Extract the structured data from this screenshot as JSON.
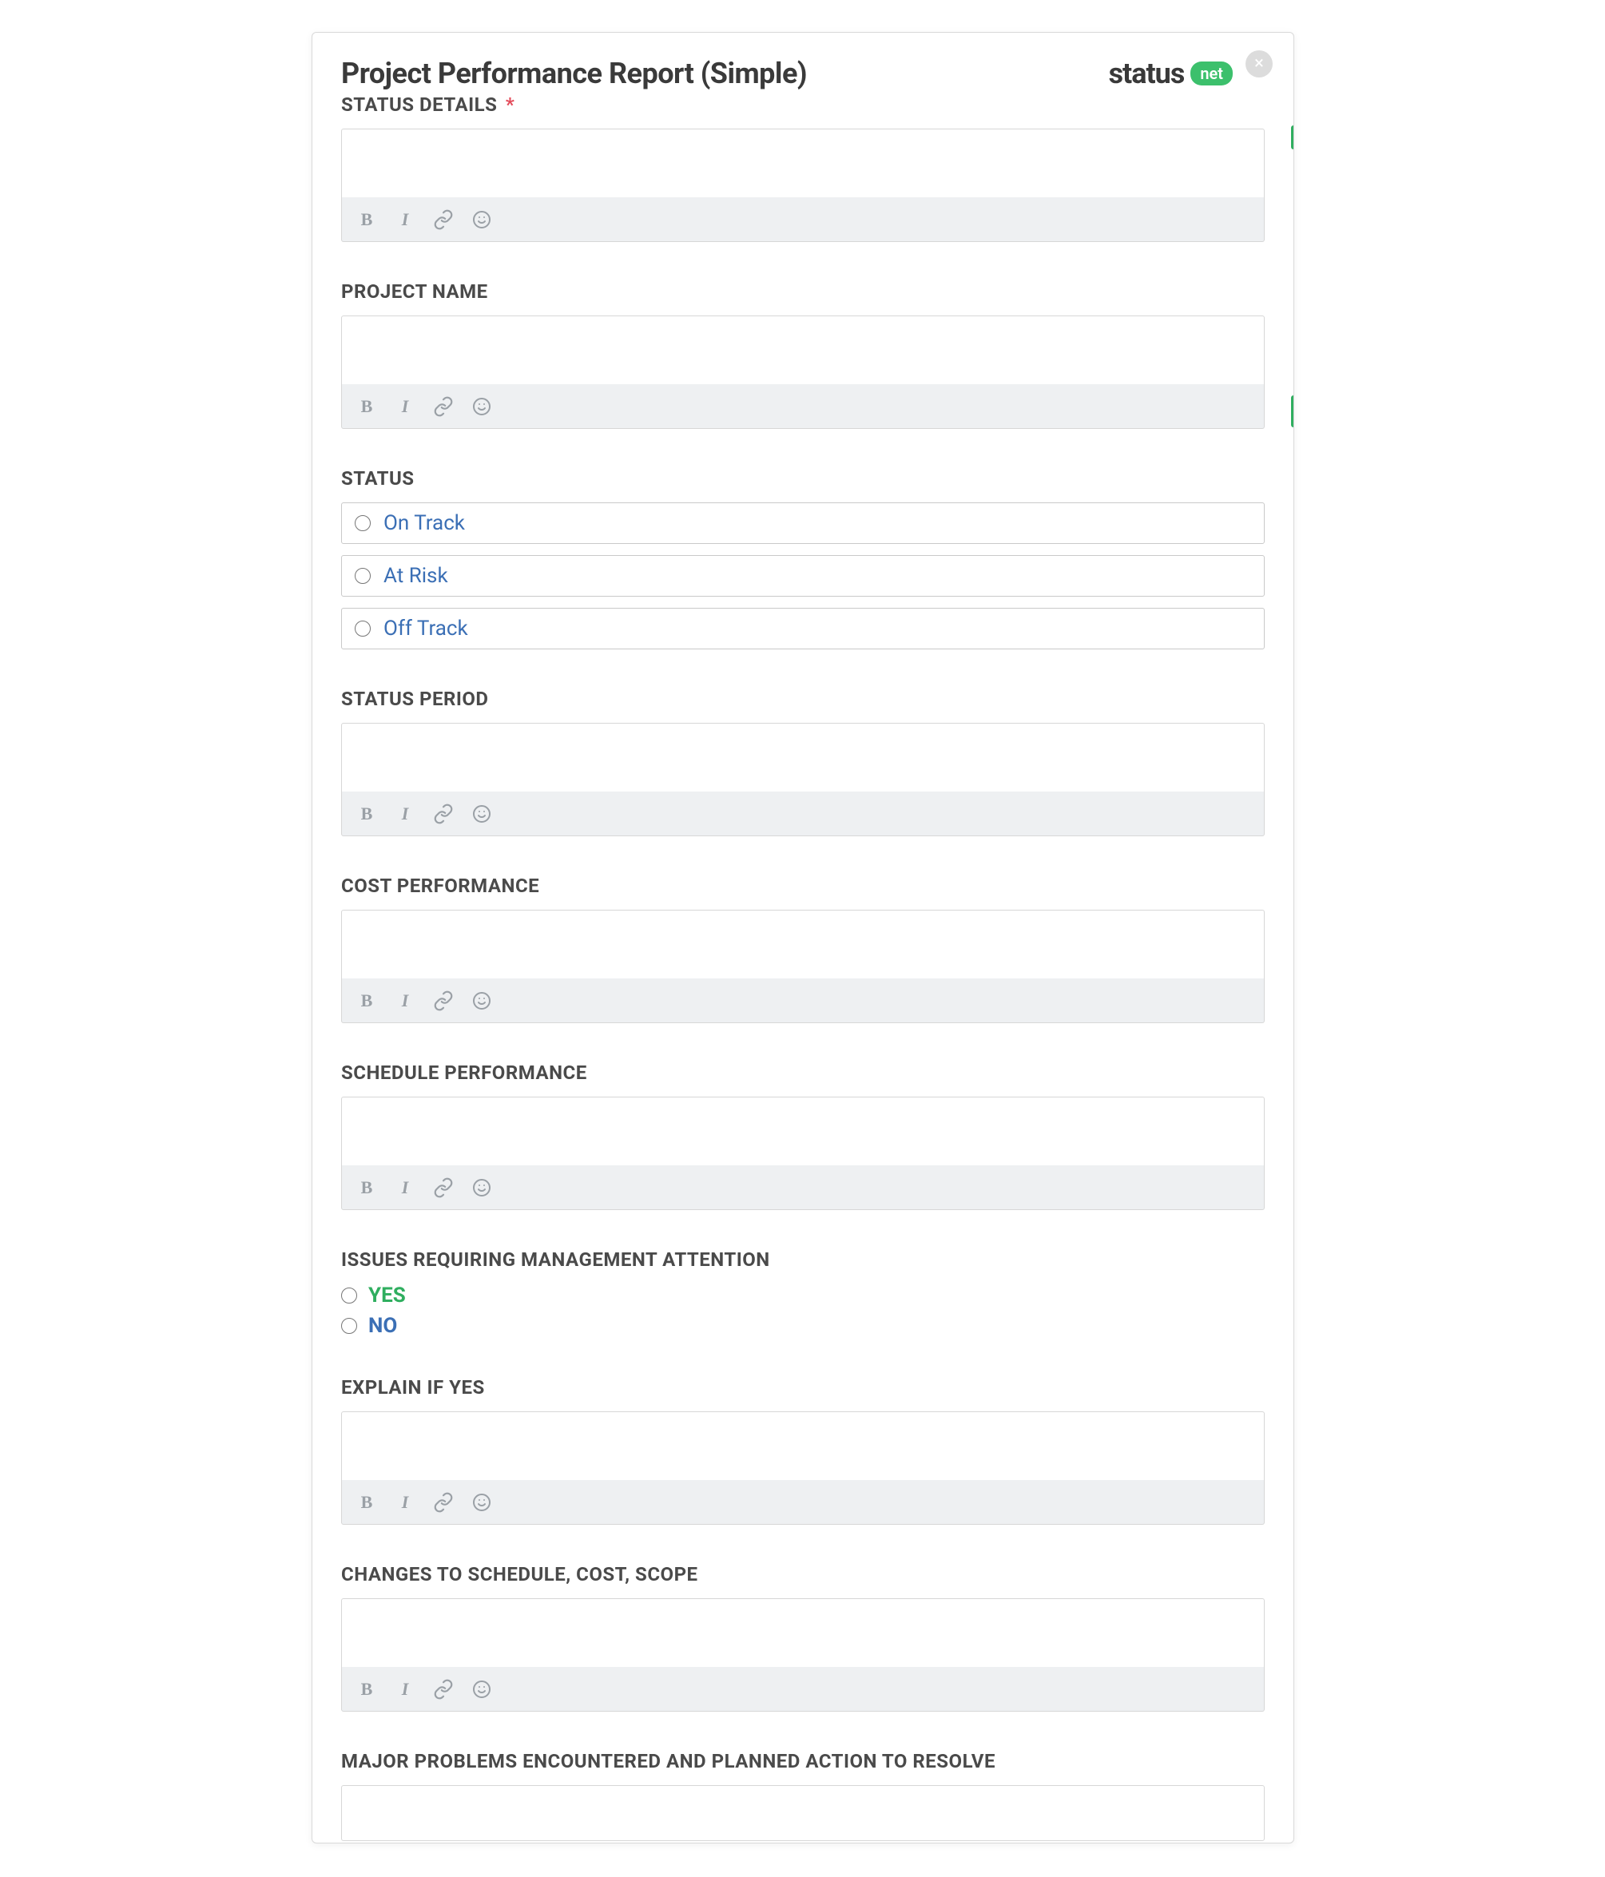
{
  "header": {
    "title": "Project Performance Report (Simple)",
    "brand_text": "status",
    "brand_badge": "net",
    "close_glyph": "×"
  },
  "toolbar": {
    "bold_glyph": "B",
    "italic_glyph": "I"
  },
  "sections": {
    "status_details": {
      "label": "STATUS DETAILS",
      "required": "*",
      "value": ""
    },
    "project_name": {
      "label": "PROJECT NAME",
      "value": ""
    },
    "status": {
      "label": "STATUS",
      "options": [
        "On Track",
        "At Risk",
        "Off Track"
      ]
    },
    "status_period": {
      "label": "STATUS PERIOD",
      "value": ""
    },
    "cost_perf": {
      "label": "COST PERFORMANCE",
      "value": ""
    },
    "schedule_perf": {
      "label": "SCHEDULE PERFORMANCE",
      "value": ""
    },
    "issues": {
      "label": "ISSUES REQUIRING MANAGEMENT ATTENTION",
      "options": [
        "YES",
        "NO"
      ]
    },
    "explain_if_yes": {
      "label": "EXPLAIN IF YES",
      "value": ""
    },
    "changes": {
      "label": "CHANGES TO SCHEDULE, COST, SCOPE",
      "value": ""
    },
    "major_problems": {
      "label": "MAJOR PROBLEMS ENCOUNTERED AND PLANNED ACTION TO RESOLVE",
      "value": ""
    }
  }
}
